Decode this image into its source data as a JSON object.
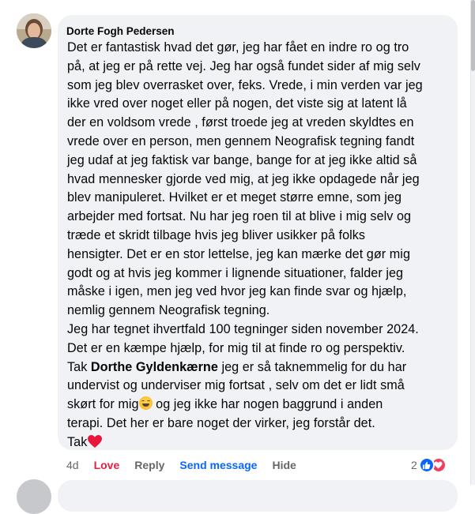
{
  "comment": {
    "author": "Dorte Fogh Pedersen",
    "lines": [
      "Det er fantastisk hvad det gør, jeg har fået en indre ro og tro",
      "på, at jeg er på rette vej. Jeg har også fundet sider af mig selv",
      "som jeg blev overrasket over, feks. Vrede, i min verden var jeg",
      "ikke vred over noget eller på nogen, det viste sig at latent lå",
      "der en voldsom vrede , først troede jeg at vreden skyldtes en",
      "vrede over en person, men gennem Neografisk tegning fandt",
      "jeg udaf at jeg faktisk var bange, bange for at jeg ikke altid så",
      "hvad mennesker gjorde ved mig, at jeg ikke opdagede når jeg",
      "blev manipuleret. Hvilket er et meget større emne, som jeg",
      "arbejder med fortsat. Nu har jeg roen til at blive i mig selv og",
      "træde et skridt tilbage hvis jeg bliver usikker på folks",
      "hensigter. Det er en stor lettelse, jeg kan mærke det gør mig",
      "godt og at hvis jeg kommer i lignende situationer, falder jeg",
      "måske i igen, men jeg ved hvor jeg kan finde svar og hjælp,",
      "nemlig gennem Neografisk tegning.",
      "Jeg har tegnet ihvertfald 100 tegninger siden november 2024.",
      "Det er en kæmpe hjælp, for mig til at finde ro og perspektiv."
    ],
    "tak_prefix": "Tak ",
    "mention": "Dorthe Gyldenkærne",
    "tak_suffix": " jeg er så taknemmelig for du har",
    "line_19": "undervist og underviser mig fortsat , selv om det er lidt små",
    "line_20_before_emoji": "skørt for mig",
    "line_20_after_emoji": " og jeg ikke har nogen baggrund i anden",
    "line_21": "terapi. Det her er bare noget der virker, jeg forstår det.",
    "closing": "Tak",
    "emoji_name": "grinning-sweat-emoji",
    "heart_name": "red-heart-emoji"
  },
  "actions": {
    "time": "4d",
    "love": "Love",
    "reply": "Reply",
    "send_message": "Send message",
    "hide": "Hide"
  },
  "reactions": {
    "count": "2",
    "types": [
      "like-icon",
      "love-icon"
    ]
  },
  "colors": {
    "bubble": "#f0f2f5",
    "love": "#e41e3f",
    "link": "#0866ff",
    "muted": "#65676b"
  }
}
